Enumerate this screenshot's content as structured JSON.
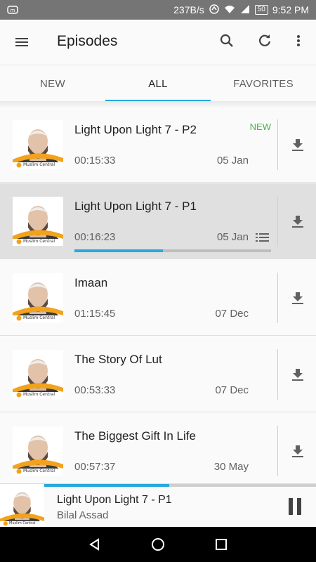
{
  "status_bar": {
    "net_speed": "237B/s",
    "battery": "50",
    "time": "9:52 PM"
  },
  "app_bar": {
    "title": "Episodes",
    "menu_icon": "menu-icon",
    "search_icon": "search-icon",
    "refresh_icon": "refresh-icon",
    "more_icon": "more-vert-icon"
  },
  "tabs": [
    {
      "label": "NEW",
      "active": false
    },
    {
      "label": "ALL",
      "active": true
    },
    {
      "label": "FAVORITES",
      "active": false
    }
  ],
  "episodes": [
    {
      "title": "Light Upon Light 7 - P2",
      "duration": "00:15:33",
      "date": "05 Jan",
      "badge": "NEW",
      "playing": false
    },
    {
      "title": "Light Upon Light 7 - P1",
      "duration": "00:16:23",
      "date": "05 Jan",
      "badge": "",
      "playing": true,
      "progress": 0.45
    },
    {
      "title": "Imaan",
      "duration": "01:15:45",
      "date": "07 Dec",
      "badge": "",
      "playing": false
    },
    {
      "title": "The Story Of Lut",
      "duration": "00:53:33",
      "date": "07 Dec",
      "badge": "",
      "playing": false
    },
    {
      "title": "The Biggest Gift In Life",
      "duration": "00:57:37",
      "date": "30 May",
      "badge": "",
      "playing": false
    }
  ],
  "thumbnail_brand": "Muslim Central",
  "mini_player": {
    "title": "Light Upon Light 7 - P1",
    "author": "Bilal Assad",
    "progress": 0.46
  },
  "colors": {
    "accent": "#29a8dc",
    "new_badge": "#4caf50",
    "playing_row": "#e0e0e0"
  }
}
